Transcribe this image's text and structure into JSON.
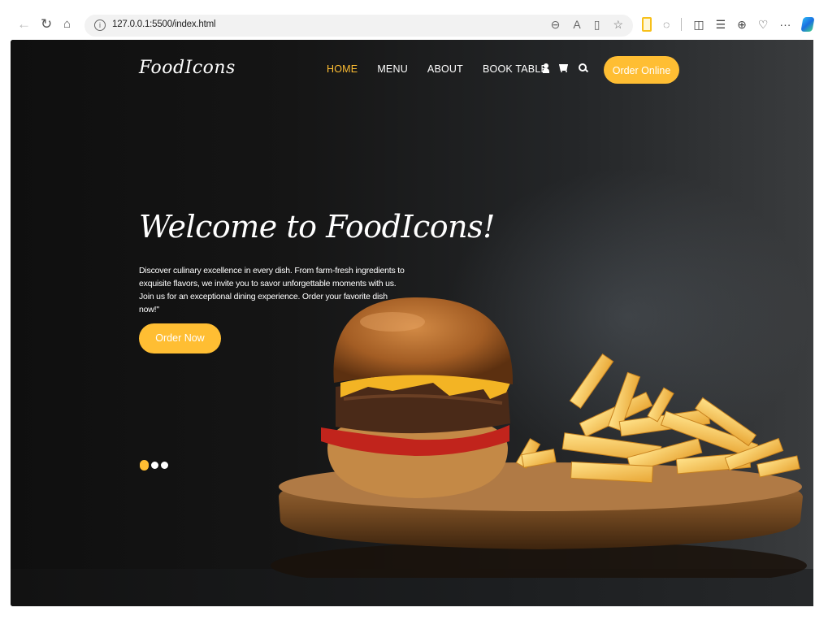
{
  "browser": {
    "url": "127.0.0.1:5500/index.html",
    "icons": {
      "back": "back-arrow-icon",
      "refresh": "refresh-icon",
      "home": "home-icon",
      "info": "info-icon"
    },
    "toolbar_more": "···"
  },
  "site": {
    "logo": "FoodIcons",
    "nav": [
      {
        "label": "HOME",
        "active": true
      },
      {
        "label": "MENU",
        "active": false
      },
      {
        "label": "ABOUT",
        "active": false
      },
      {
        "label": "BOOK TABLE",
        "active": false
      }
    ],
    "order_online_label": "Order Online",
    "accent_color": "#ffbe33"
  },
  "hero": {
    "title": "Welcome to FoodIcons!",
    "description": "Discover culinary excellence in every dish. From farm-fresh ingredients to exquisite flavors, we invite you to savor unforgettable moments with us. Join us for an exceptional dining experience. Order your favorite dish now!\"",
    "cta_label": "Order Now",
    "slides": {
      "count": 3,
      "active": 1
    }
  }
}
